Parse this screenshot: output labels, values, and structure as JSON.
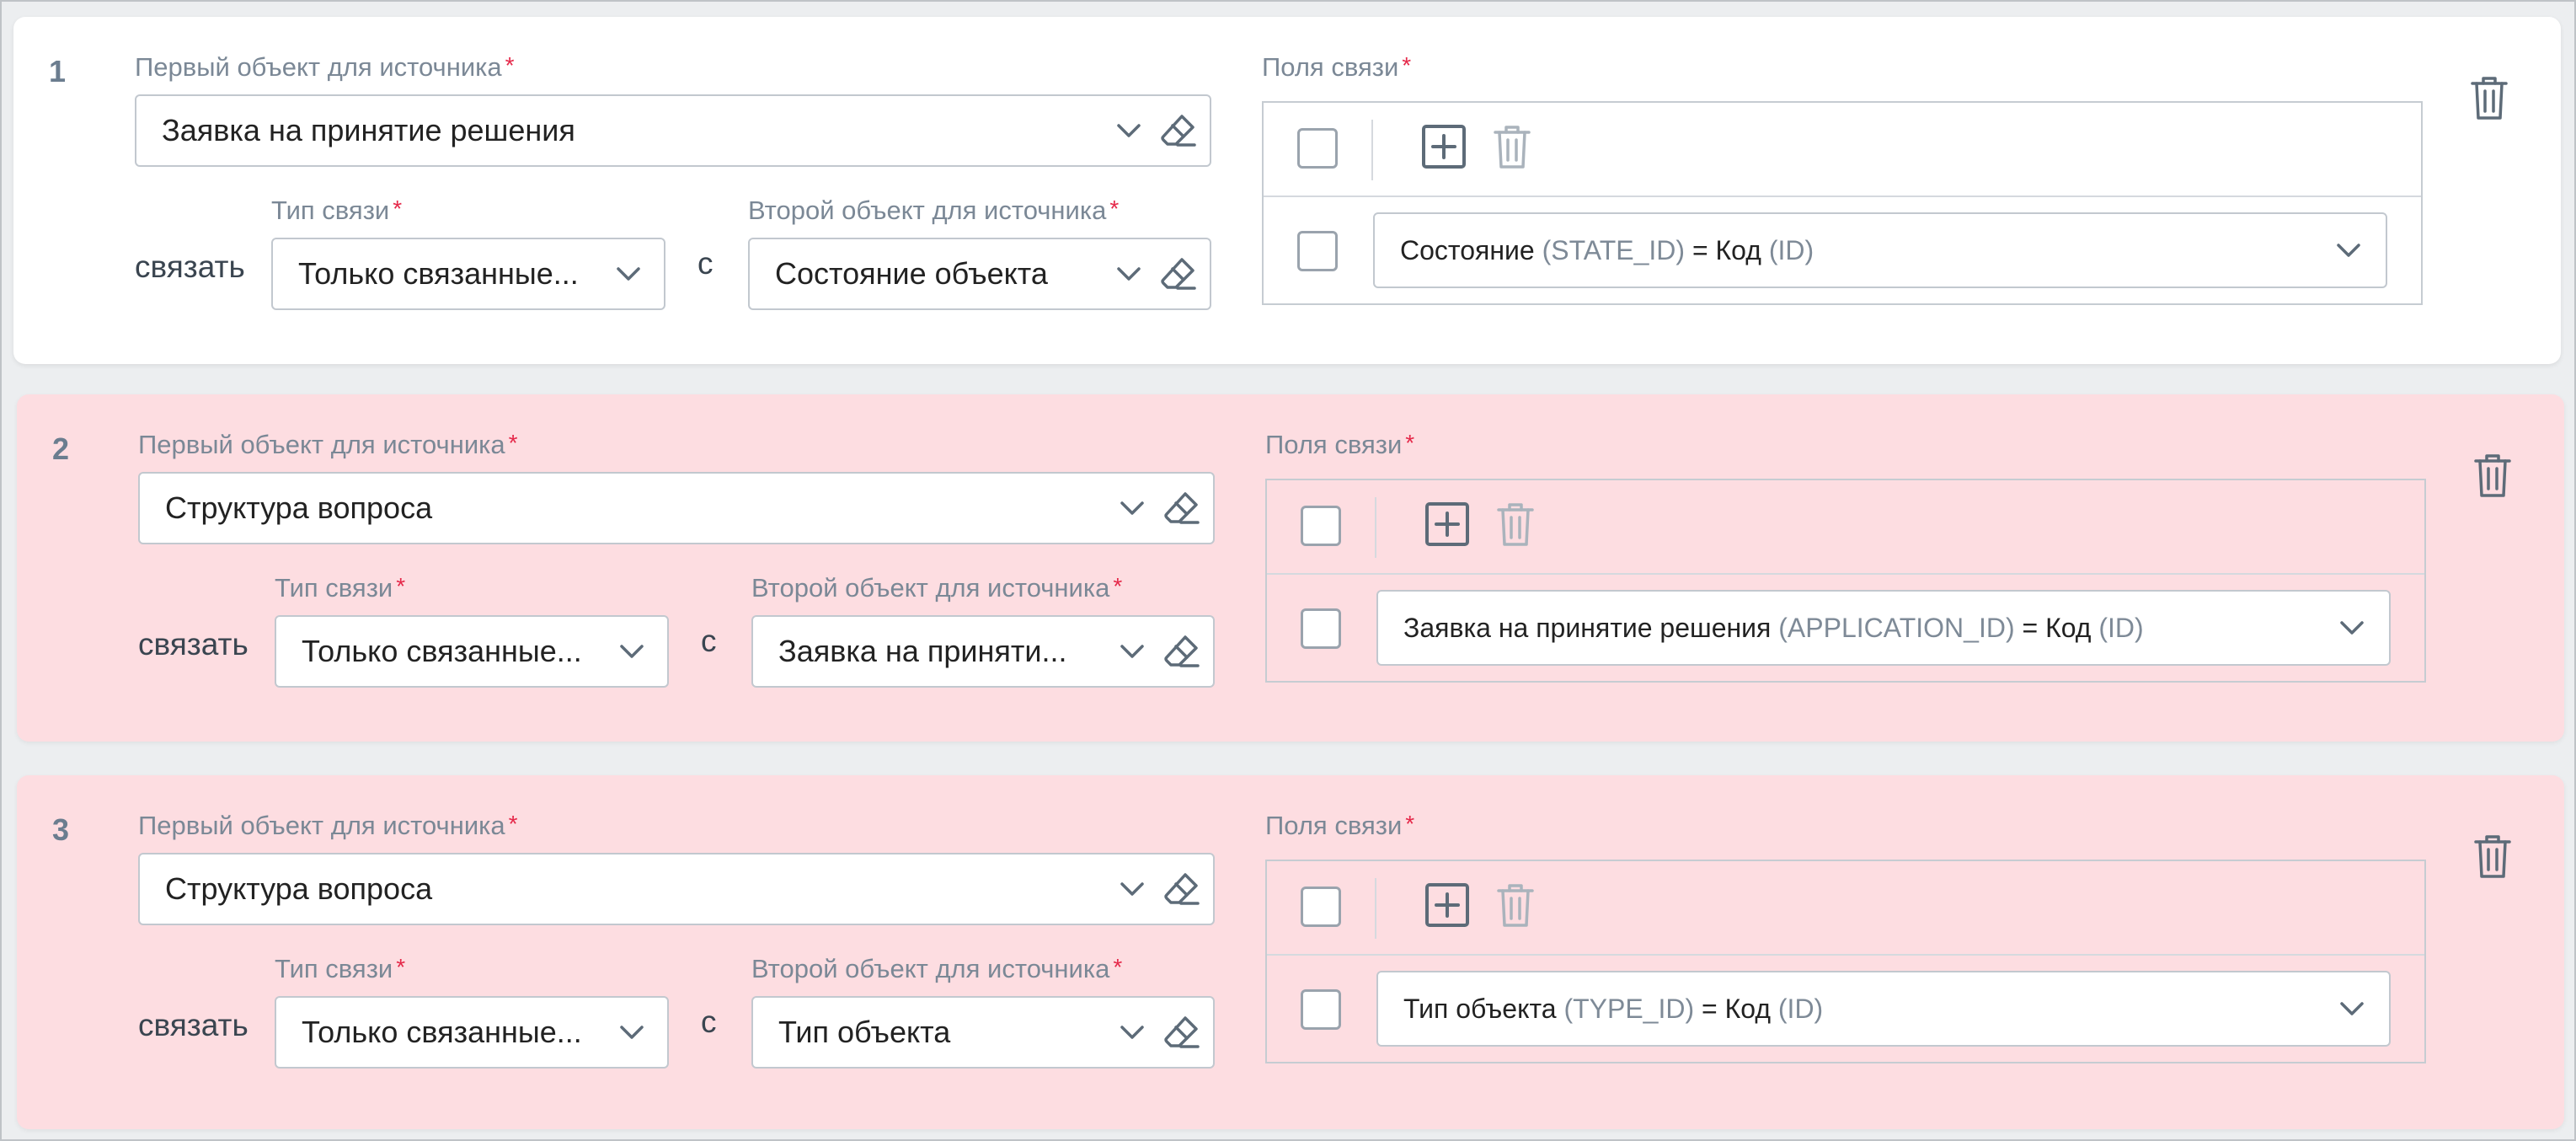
{
  "rows": [
    {
      "number": "1",
      "state": "ok",
      "first_object": {
        "label": "Первый объект для источника",
        "value": "Заявка на принятие решения"
      },
      "link_word": "связать",
      "link_type": {
        "label": "Тип связи",
        "value": "Только связанные..."
      },
      "with_word": "с",
      "second_object": {
        "label": "Второй объект для источника",
        "value": "Состояние объекта"
      },
      "link_fields": {
        "label": "Поля связи",
        "item": {
          "name": "Состояние",
          "code": "(STATE_ID)",
          "eq": "=",
          "target": "Код",
          "target_code": "(ID)"
        }
      }
    },
    {
      "number": "2",
      "state": "error",
      "first_object": {
        "label": "Первый объект для источника",
        "value": "Структура вопроса"
      },
      "link_word": "связать",
      "link_type": {
        "label": "Тип связи",
        "value": "Только связанные..."
      },
      "with_word": "с",
      "second_object": {
        "label": "Второй объект для источника",
        "value": "Заявка на приняти..."
      },
      "link_fields": {
        "label": "Поля связи",
        "item": {
          "name": "Заявка на принятие решения",
          "code": "(APPLICATION_ID)",
          "eq": "=",
          "target": "Код",
          "target_code": "(ID)"
        }
      }
    },
    {
      "number": "3",
      "state": "error",
      "first_object": {
        "label": "Первый объект для источника",
        "value": "Структура вопроса"
      },
      "link_word": "связать",
      "link_type": {
        "label": "Тип связи",
        "value": "Только связанные..."
      },
      "with_word": "с",
      "second_object": {
        "label": "Второй объект для источника",
        "value": "Тип объекта"
      },
      "link_fields": {
        "label": "Поля связи",
        "item": {
          "name": "Тип объекта",
          "code": "(TYPE_ID)",
          "eq": "=",
          "target": "Код",
          "target_code": "(ID)"
        }
      }
    }
  ],
  "required_mark": "*",
  "colors": {
    "error_bg": "#fddde1",
    "ok_bg": "#ffffff",
    "required": "#e5294a",
    "icon": "#6b7d8f"
  },
  "icons": [
    "chevron-down-icon",
    "eraser-icon",
    "checkbox",
    "add-square-icon",
    "trash-icon"
  ]
}
